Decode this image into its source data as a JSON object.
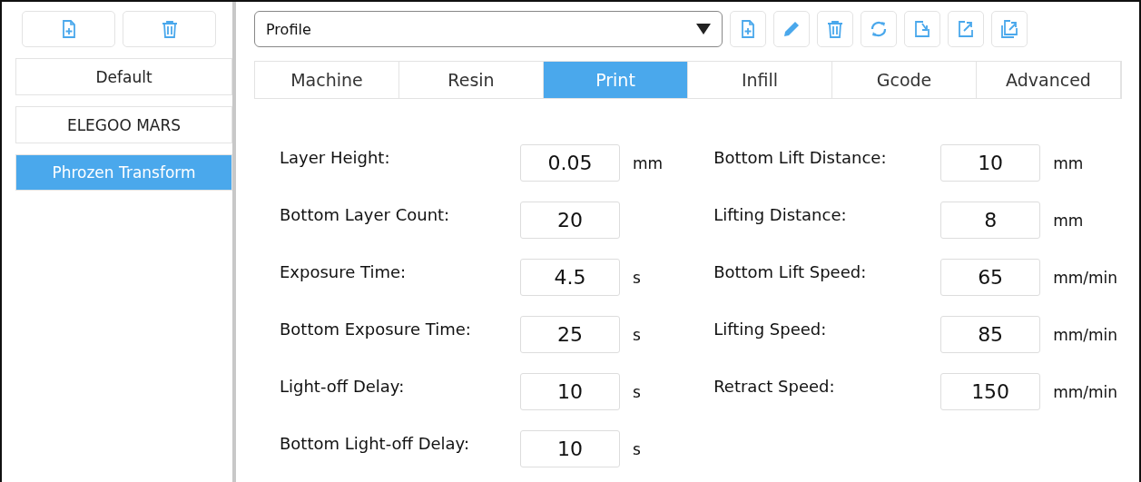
{
  "profiles": [
    {
      "label": "Default",
      "selected": false
    },
    {
      "label": "ELEGOO MARS",
      "selected": false
    },
    {
      "label": "Phrozen Transform",
      "selected": true
    }
  ],
  "profile_dropdown": {
    "value": "Profile"
  },
  "tabs": [
    {
      "label": "Machine",
      "selected": false
    },
    {
      "label": "Resin",
      "selected": false
    },
    {
      "label": "Print",
      "selected": true
    },
    {
      "label": "Infill",
      "selected": false
    },
    {
      "label": "Gcode",
      "selected": false
    },
    {
      "label": "Advanced",
      "selected": false
    }
  ],
  "settings_left": [
    {
      "label": "Layer Height:",
      "value": "0.05",
      "unit": "mm"
    },
    {
      "label": "Bottom Layer Count:",
      "value": "20"
    },
    {
      "label": "Exposure Time:",
      "value": "4.5",
      "unit": "s"
    },
    {
      "label": "Bottom Exposure Time:",
      "value": "25",
      "unit": "s"
    },
    {
      "label": "Light-off Delay:",
      "value": "10",
      "unit": "s"
    },
    {
      "label": "Bottom Light-off Delay:",
      "value": "10",
      "unit": "s"
    }
  ],
  "settings_right": [
    {
      "label": "Bottom Lift Distance:",
      "value": "10",
      "unit": "mm"
    },
    {
      "label": "Lifting Distance:",
      "value": "8",
      "unit": "mm"
    },
    {
      "label": "Bottom Lift Speed:",
      "value": "65",
      "unit": "mm/min"
    },
    {
      "label": "Lifting Speed:",
      "value": "85",
      "unit": "mm/min"
    },
    {
      "label": "Retract Speed:",
      "value": "150",
      "unit": "mm/min"
    }
  ]
}
